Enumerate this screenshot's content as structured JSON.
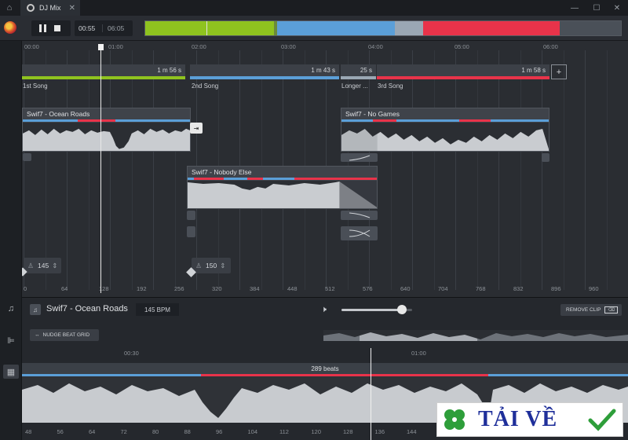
{
  "window": {
    "tab_title": "DJ Mix",
    "tab_close": "✕",
    "controls": [
      "—",
      "☐",
      "✕"
    ]
  },
  "transport": {
    "current_time": "00:55",
    "total_time": "06:05"
  },
  "overview_colors": {
    "green": "#8fc31f",
    "blue": "#5b9fd8",
    "grey": "#9aa7b4",
    "red": "#e8334a",
    "dark": "#4a5058"
  },
  "timeline": {
    "time_markers": [
      "00:00",
      "01:00",
      "02:00",
      "03:00",
      "04:00",
      "05:00",
      "06:00"
    ],
    "beat_markers": [
      "0",
      "64",
      "128",
      "192",
      "256",
      "320",
      "384",
      "448",
      "512",
      "576",
      "640",
      "704",
      "768",
      "832",
      "896",
      "960"
    ],
    "songs": [
      {
        "name": "1st Song",
        "duration": "1 m  56 s",
        "color": "#8fc31f"
      },
      {
        "name": "2nd Song",
        "duration": "1 m  43 s",
        "color": "#5b9fd8"
      },
      {
        "name": "Longer ...",
        "duration": "25 s",
        "color": "#9aa7b4"
      },
      {
        "name": "3rd Song",
        "duration": "1 m  58 s",
        "color": "#e8334a"
      }
    ],
    "add_song": "+",
    "clips": [
      {
        "title": "Swif7 - Ocean Roads"
      },
      {
        "title": "Swif7 - Nobody Else"
      },
      {
        "title": "Swif7 - No Games"
      }
    ],
    "bpm_values": [
      "145",
      "150"
    ]
  },
  "editor": {
    "clip_title": "Swif7 - Ocean Roads",
    "bpm": "145 BPM",
    "volume_level": 0.85,
    "remove_clip": "REMOVE CLIP",
    "nudge_beat_grid": "NUDGE BEAT GRID",
    "time_markers": [
      "00:30",
      "01:00"
    ],
    "beats_count": "289 beats",
    "beat_markers": [
      "48",
      "56",
      "64",
      "72",
      "80",
      "88",
      "96",
      "104",
      "112",
      "120",
      "128",
      "136",
      "144"
    ]
  },
  "watermark": {
    "text": "TẢI VỀ"
  }
}
